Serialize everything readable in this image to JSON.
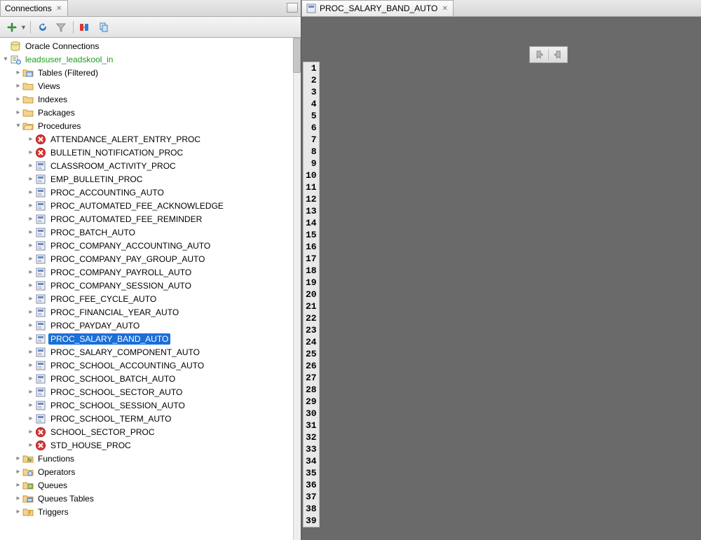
{
  "left_tab": {
    "title": "Connections"
  },
  "right_tab": {
    "title": "PROC_SALARY_BAND_AUTO"
  },
  "tree": {
    "root": "Oracle Connections",
    "connection": "leadsuser_leadskool_in",
    "folders": [
      {
        "name": "Tables (Filtered)",
        "icon": "folder-table"
      },
      {
        "name": "Views",
        "icon": "folder"
      },
      {
        "name": "Indexes",
        "icon": "folder"
      },
      {
        "name": "Packages",
        "icon": "folder"
      }
    ],
    "procedures_label": "Procedures",
    "procedures": [
      {
        "name": "ATTENDANCE_ALERT_ENTRY_PROC",
        "error": true
      },
      {
        "name": "BULLETIN_NOTIFICATION_PROC",
        "error": true
      },
      {
        "name": "CLASSROOM_ACTIVITY_PROC",
        "error": false
      },
      {
        "name": "EMP_BULLETIN_PROC",
        "error": false
      },
      {
        "name": "PROC_ACCOUNTING_AUTO",
        "error": false
      },
      {
        "name": "PROC_AUTOMATED_FEE_ACKNOWLEDGE",
        "error": false
      },
      {
        "name": "PROC_AUTOMATED_FEE_REMINDER",
        "error": false
      },
      {
        "name": "PROC_BATCH_AUTO",
        "error": false
      },
      {
        "name": "PROC_COMPANY_ACCOUNTING_AUTO",
        "error": false
      },
      {
        "name": "PROC_COMPANY_PAY_GROUP_AUTO",
        "error": false
      },
      {
        "name": "PROC_COMPANY_PAYROLL_AUTO",
        "error": false
      },
      {
        "name": "PROC_COMPANY_SESSION_AUTO",
        "error": false
      },
      {
        "name": "PROC_FEE_CYCLE_AUTO",
        "error": false
      },
      {
        "name": "PROC_FINANCIAL_YEAR_AUTO",
        "error": false
      },
      {
        "name": "PROC_PAYDAY_AUTO",
        "error": false
      },
      {
        "name": "PROC_SALARY_BAND_AUTO",
        "error": false,
        "selected": true
      },
      {
        "name": "PROC_SALARY_COMPONENT_AUTO",
        "error": false
      },
      {
        "name": "PROC_SCHOOL_ACCOUNTING_AUTO",
        "error": false
      },
      {
        "name": "PROC_SCHOOL_BATCH_AUTO",
        "error": false
      },
      {
        "name": "PROC_SCHOOL_SECTOR_AUTO",
        "error": false
      },
      {
        "name": "PROC_SCHOOL_SESSION_AUTO",
        "error": false
      },
      {
        "name": "PROC_SCHOOL_TERM_AUTO",
        "error": false
      },
      {
        "name": "SCHOOL_SECTOR_PROC",
        "error": true
      },
      {
        "name": "STD_HOUSE_PROC",
        "error": true
      }
    ],
    "below": [
      {
        "name": "Functions",
        "icon": "fx"
      },
      {
        "name": "Operators",
        "icon": "op"
      },
      {
        "name": "Queues",
        "icon": "queue"
      },
      {
        "name": "Queues Tables",
        "icon": "queue-table"
      },
      {
        "name": "Triggers",
        "icon": "trigger"
      }
    ]
  },
  "gutter_lines": 39
}
